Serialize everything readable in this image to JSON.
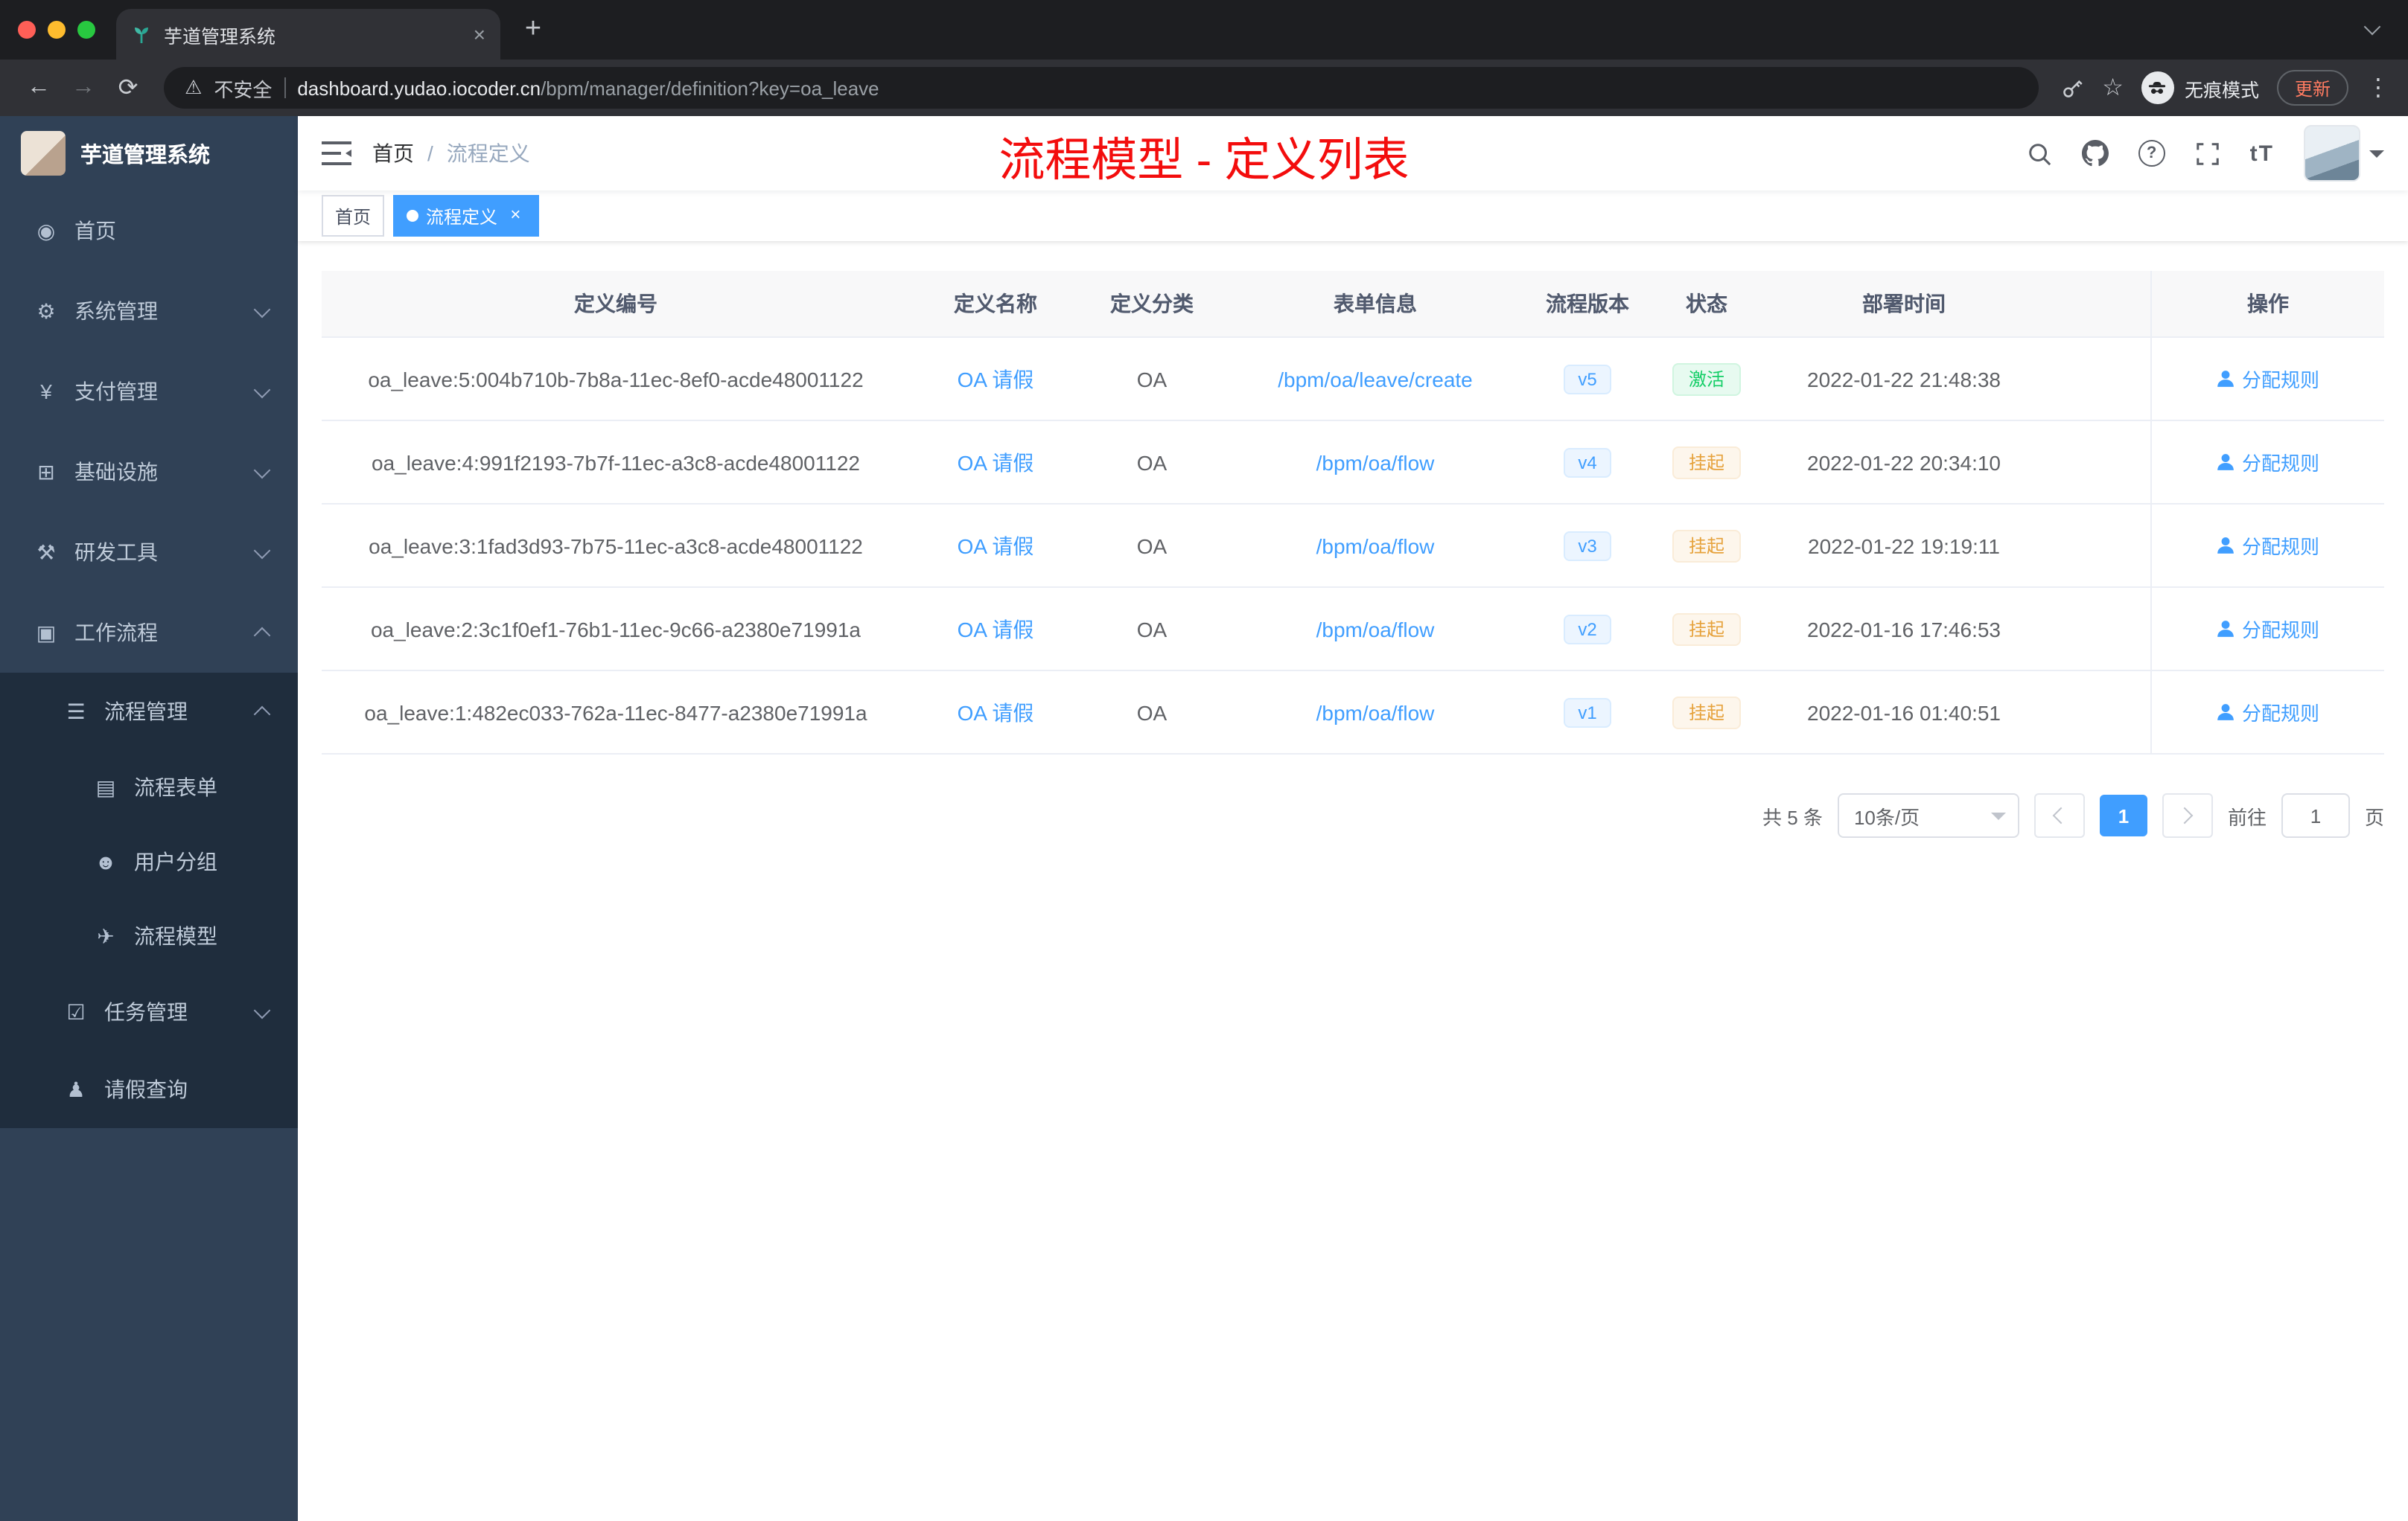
{
  "browser": {
    "tab_title": "芋道管理系统",
    "security_label": "不安全",
    "url_host": "dashboard.yudao.iocoder.cn",
    "url_path": "/bpm/manager/definition?key=oa_leave",
    "incognito_label": "无痕模式",
    "update_label": "更新"
  },
  "sidebar": {
    "logo_title": "芋道管理系统",
    "items": [
      {
        "label": "首页",
        "icon": "dashboard-icon",
        "level": 0,
        "chevron": "none"
      },
      {
        "label": "系统管理",
        "icon": "settings-icon",
        "level": 0,
        "chevron": "down"
      },
      {
        "label": "支付管理",
        "icon": "payment-icon",
        "level": 0,
        "chevron": "down"
      },
      {
        "label": "基础设施",
        "icon": "infrastructure-icon",
        "level": 0,
        "chevron": "down"
      },
      {
        "label": "研发工具",
        "icon": "devtools-icon",
        "level": 0,
        "chevron": "down"
      },
      {
        "label": "工作流程",
        "icon": "workflow-icon",
        "level": 0,
        "chevron": "up"
      },
      {
        "label": "流程管理",
        "icon": "process-icon",
        "level": 1,
        "chevron": "up"
      },
      {
        "label": "流程表单",
        "icon": "form-icon",
        "level": 2,
        "chevron": "none"
      },
      {
        "label": "用户分组",
        "icon": "usergroup-icon",
        "level": 2,
        "chevron": "none"
      },
      {
        "label": "流程模型",
        "icon": "model-icon",
        "level": 2,
        "chevron": "none"
      },
      {
        "label": "任务管理",
        "icon": "task-icon",
        "level": 1,
        "chevron": "down"
      },
      {
        "label": "请假查询",
        "icon": "leave-person-icon",
        "level": 1,
        "chevron": "none"
      }
    ]
  },
  "navbar": {
    "breadcrumb_home": "首页",
    "breadcrumb_separator": "/",
    "breadcrumb_current": "流程定义",
    "annotation": "流程模型 - 定义列表"
  },
  "tags": [
    {
      "label": "首页",
      "active": false
    },
    {
      "label": "流程定义",
      "active": true
    }
  ],
  "table": {
    "columns": [
      "定义编号",
      "定义名称",
      "定义分类",
      "表单信息",
      "流程版本",
      "状态",
      "部署时间",
      "操作"
    ],
    "rows": [
      {
        "id": "oa_leave:5:004b710b-7b8a-11ec-8ef0-acde48001122",
        "name": "OA 请假",
        "category": "OA",
        "form": "/bpm/oa/leave/create",
        "version": "v5",
        "status": "激活",
        "status_type": "success",
        "deployed_at": "2022-01-22 21:48:38",
        "action": "分配规则"
      },
      {
        "id": "oa_leave:4:991f2193-7b7f-11ec-a3c8-acde48001122",
        "name": "OA 请假",
        "category": "OA",
        "form": "/bpm/oa/flow",
        "version": "v4",
        "status": "挂起",
        "status_type": "warning",
        "deployed_at": "2022-01-22 20:34:10",
        "action": "分配规则"
      },
      {
        "id": "oa_leave:3:1fad3d93-7b75-11ec-a3c8-acde48001122",
        "name": "OA 请假",
        "category": "OA",
        "form": "/bpm/oa/flow",
        "version": "v3",
        "status": "挂起",
        "status_type": "warning",
        "deployed_at": "2022-01-22 19:19:11",
        "action": "分配规则"
      },
      {
        "id": "oa_leave:2:3c1f0ef1-76b1-11ec-9c66-a2380e71991a",
        "name": "OA 请假",
        "category": "OA",
        "form": "/bpm/oa/flow",
        "version": "v2",
        "status": "挂起",
        "status_type": "warning",
        "deployed_at": "2022-01-16 17:46:53",
        "action": "分配规则"
      },
      {
        "id": "oa_leave:1:482ec033-762a-11ec-8477-a2380e71991a",
        "name": "OA 请假",
        "category": "OA",
        "form": "/bpm/oa/flow",
        "version": "v1",
        "status": "挂起",
        "status_type": "warning",
        "deployed_at": "2022-01-16 01:40:51",
        "action": "分配规则"
      }
    ]
  },
  "pagination": {
    "total": "共 5 条",
    "page_size": "10条/页",
    "current_page": "1",
    "goto_label": "前往",
    "goto_value": "1",
    "goto_unit": "页"
  },
  "colors": {
    "accent": "#409eff",
    "success": "#13ce66",
    "warning": "#e6a23c",
    "annotation_red": "#f30d0d",
    "sidebar_bg": "#304156",
    "submenu_bg": "#1f2d3d"
  }
}
